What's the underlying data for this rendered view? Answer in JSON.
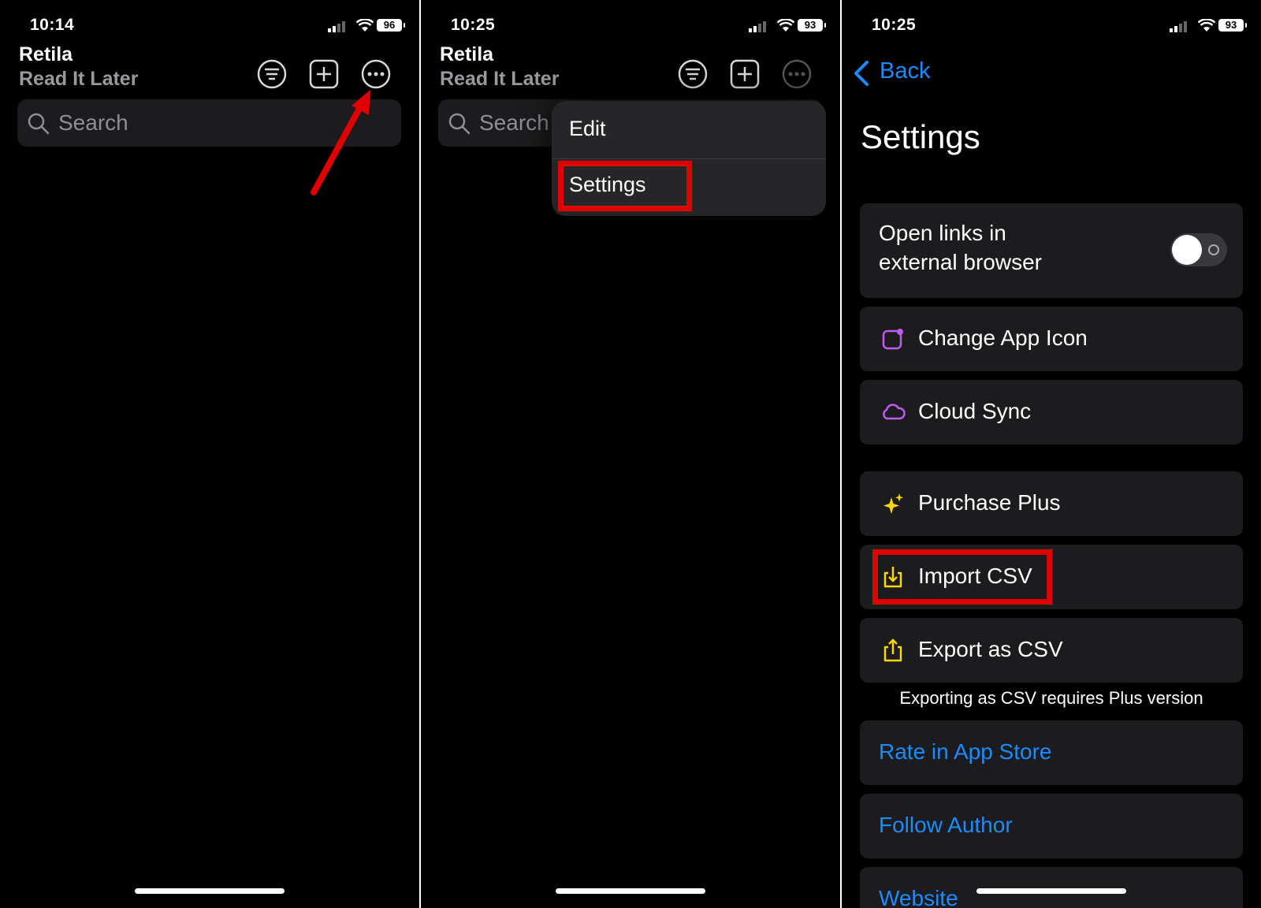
{
  "panels": [
    {
      "status": {
        "time": "10:14",
        "battery": "96"
      },
      "header": {
        "title": "Retila",
        "subtitle": "Read It Later"
      },
      "search": {
        "placeholder": "Search"
      },
      "annotation": {
        "type": "arrow",
        "color": "#e00000",
        "target": "more-button"
      }
    },
    {
      "status": {
        "time": "10:25",
        "battery": "93"
      },
      "header": {
        "title": "Retila",
        "subtitle": "Read It Later"
      },
      "search": {
        "placeholder": "Search"
      },
      "menu": {
        "items": [
          "Edit",
          "Settings"
        ],
        "highlighted": "Settings"
      }
    },
    {
      "status": {
        "time": "10:25",
        "battery": "93"
      },
      "nav": {
        "back_label": "Back"
      },
      "title": "Settings",
      "toggle": {
        "label_line1": "Open links in",
        "label_line2": "external browser",
        "on": false
      },
      "items": [
        {
          "label": "Change App Icon",
          "icon": "app-icon-icon",
          "color": "#bf5af2"
        },
        {
          "label": "Cloud Sync",
          "icon": "cloud-icon",
          "color": "#bf5af2"
        },
        {
          "label": "Purchase Plus",
          "icon": "sparkles-icon",
          "color": "#ffd60a"
        },
        {
          "label": "Import CSV",
          "icon": "import-icon",
          "color": "#ffd60a"
        },
        {
          "label": "Export as CSV",
          "icon": "share-icon",
          "color": "#ffd60a"
        }
      ],
      "note": "Exporting as CSV requires Plus version",
      "links": [
        "Rate in App Store",
        "Follow Author",
        "Website"
      ],
      "highlighted": "Import CSV"
    }
  ],
  "colors": {
    "accent": "#1a8cff",
    "highlight": "#e00000",
    "background": "#000000",
    "cell": "#1c1c1e"
  }
}
